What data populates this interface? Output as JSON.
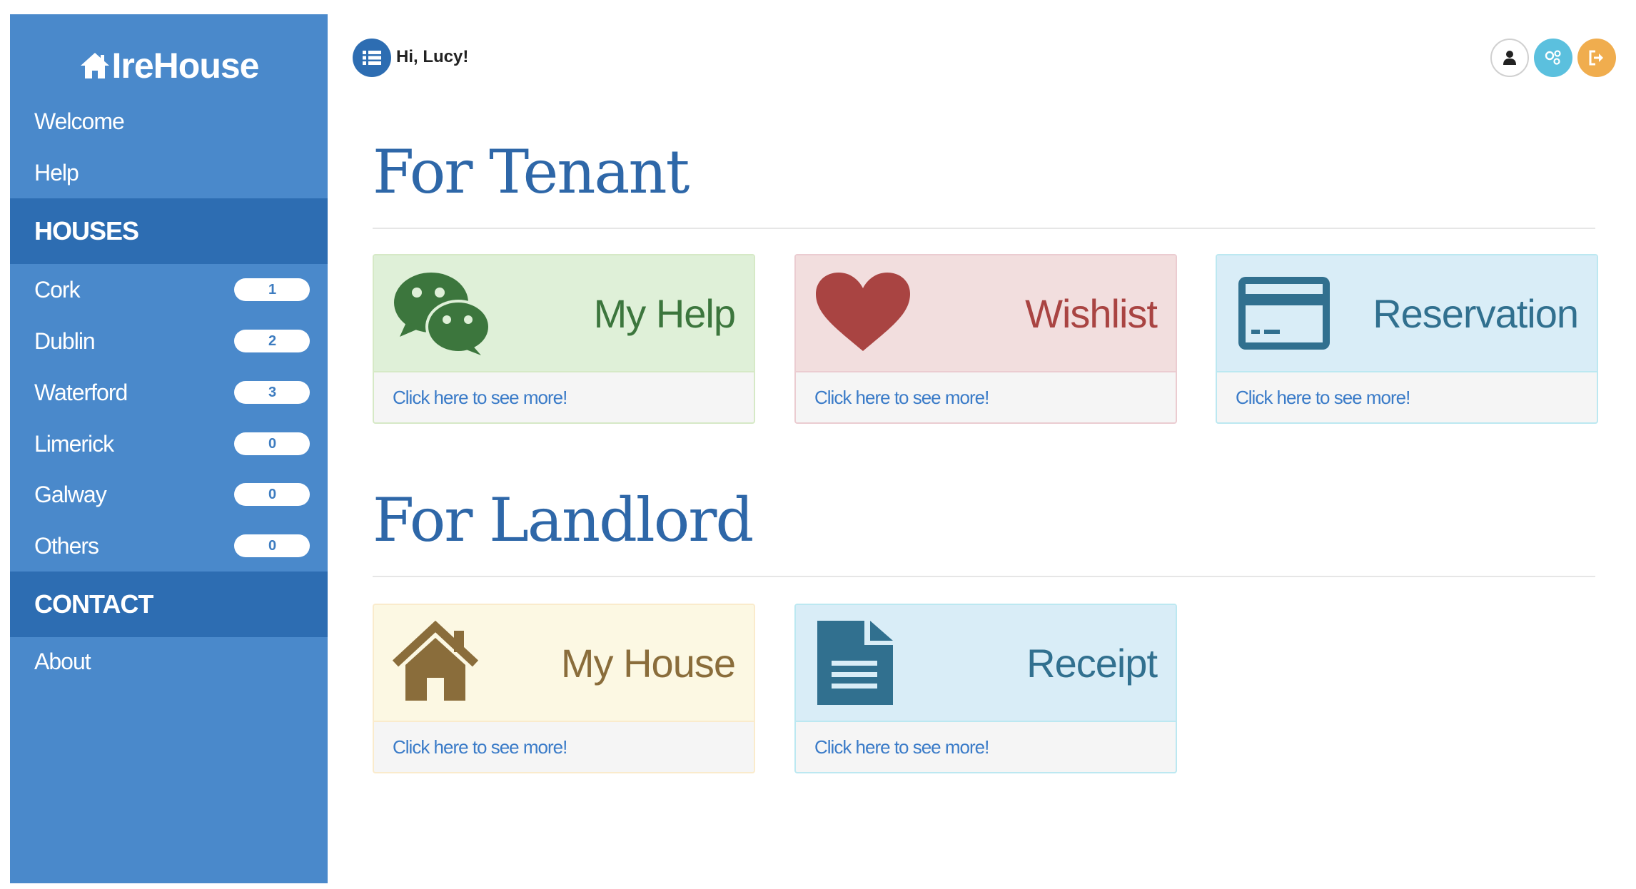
{
  "brand": {
    "name": "IreHouse"
  },
  "sidebar": {
    "top_items": [
      {
        "label": "Welcome"
      },
      {
        "label": "Help"
      }
    ],
    "houses_header": "HOUSES",
    "houses": [
      {
        "label": "Cork",
        "count": "1"
      },
      {
        "label": "Dublin",
        "count": "2"
      },
      {
        "label": "Waterford",
        "count": "3"
      },
      {
        "label": "Limerick",
        "count": "0"
      },
      {
        "label": "Galway",
        "count": "0"
      },
      {
        "label": "Others",
        "count": "0"
      }
    ],
    "contact_header": "CONTACT",
    "contact_items": [
      {
        "label": "About"
      }
    ]
  },
  "topbar": {
    "greeting": "Hi, Lucy!",
    "icons": [
      "list-icon",
      "user-icon",
      "share-icon",
      "logout-icon"
    ]
  },
  "tenant": {
    "title": "For Tenant",
    "cards": [
      {
        "title": "My Help",
        "link": "Click here to see more!",
        "icon": "wechat-icon",
        "color": "#3c763d"
      },
      {
        "title": "Wishlist",
        "link": "Click here to see more!",
        "icon": "heart-icon",
        "color": "#a94442"
      },
      {
        "title": "Reservation",
        "link": "Click here to see more!",
        "icon": "credit-card-icon",
        "color": "#31708f"
      }
    ]
  },
  "landlord": {
    "title": "For Landlord",
    "cards": [
      {
        "title": "My House",
        "link": "Click here to see more!",
        "icon": "house-icon",
        "color": "#8a6d3b"
      },
      {
        "title": "Receipt",
        "link": "Click here to see more!",
        "icon": "document-icon",
        "color": "#31708f"
      }
    ]
  },
  "colors": {
    "sidebar": "#4a89cb",
    "sidebar_header": "#2d6db2",
    "accent_share": "#5bc0de",
    "accent_logout": "#f0ad4e"
  }
}
